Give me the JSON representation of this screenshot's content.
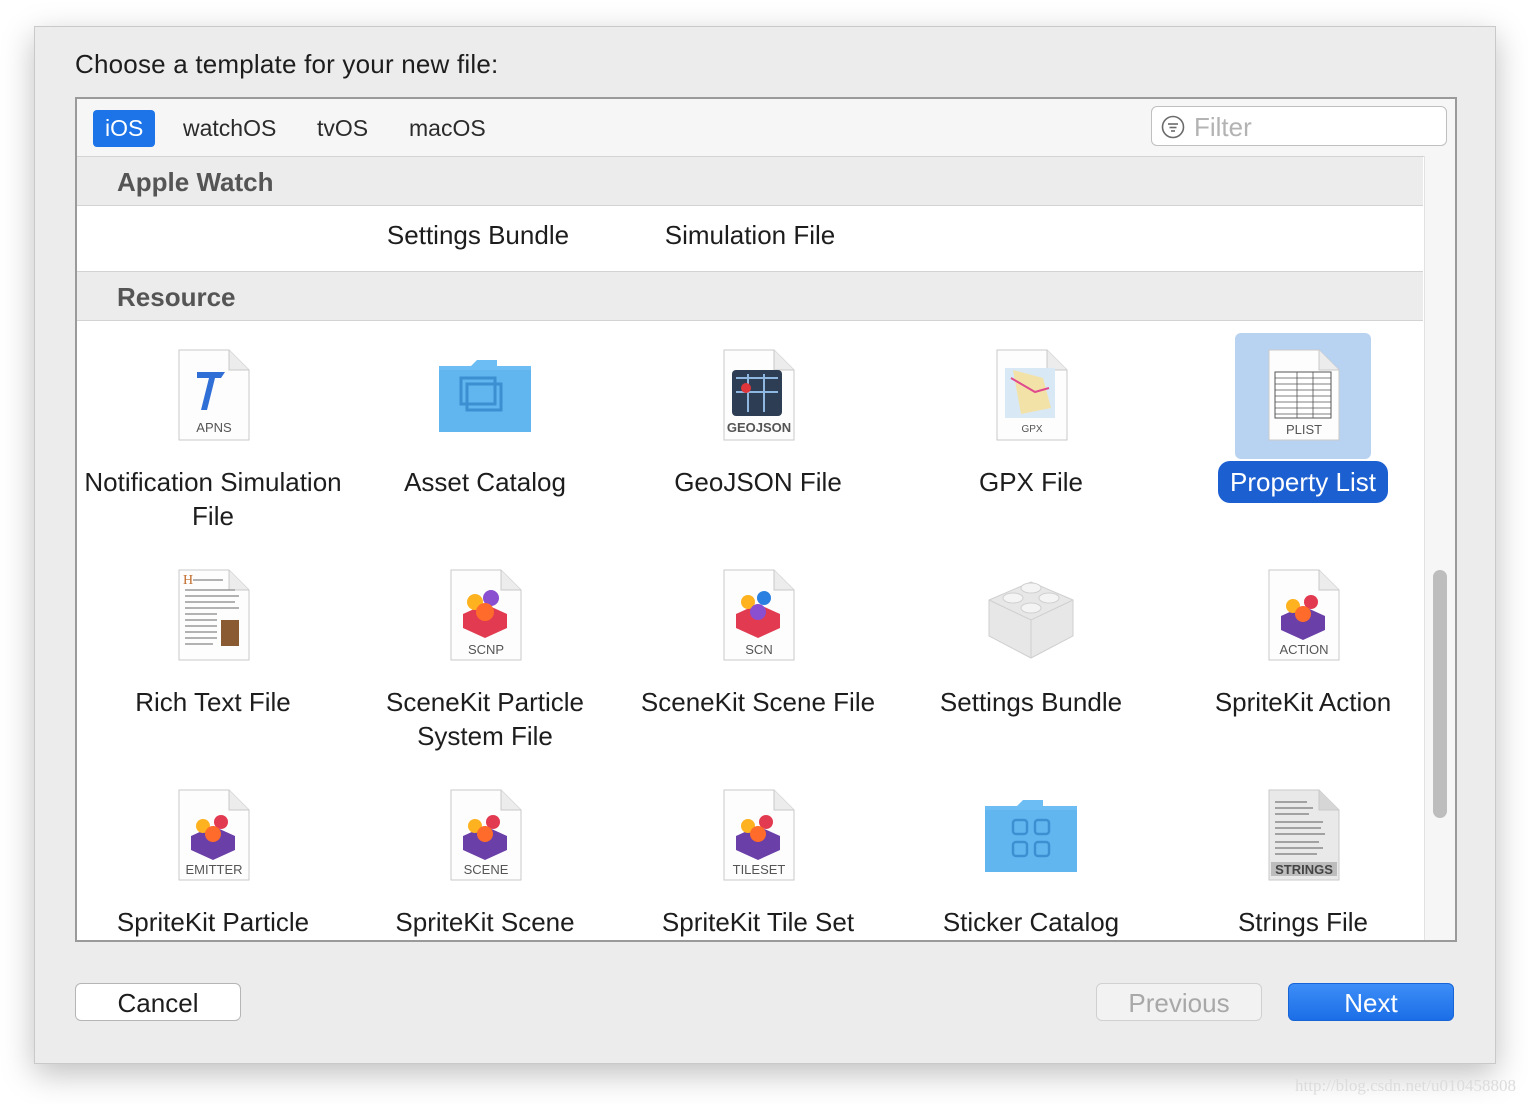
{
  "dialog": {
    "prompt": "Choose a template for your new file:",
    "cancel_label": "Cancel",
    "previous_label": "Previous",
    "next_label": "Next"
  },
  "tabs": [
    {
      "label": "iOS",
      "active": true
    },
    {
      "label": "watchOS",
      "active": false
    },
    {
      "label": "tvOS",
      "active": false
    },
    {
      "label": "macOS",
      "active": false
    }
  ],
  "filter": {
    "placeholder": "Filter",
    "value": ""
  },
  "sections": {
    "apple_watch": {
      "title": "Apple Watch",
      "partial_items": [
        "Settings Bundle",
        "Simulation File"
      ]
    },
    "resource": {
      "title": "Resource",
      "items": [
        {
          "label": "Notification Simulation File",
          "icon": "apns-file-icon",
          "tag": "APNS"
        },
        {
          "label": "Asset Catalog",
          "icon": "folder-icon",
          "tag": ""
        },
        {
          "label": "GeoJSON File",
          "icon": "geojson-file-icon",
          "tag": "GEOJSON"
        },
        {
          "label": "GPX File",
          "icon": "gpx-file-icon",
          "tag": "GPX"
        },
        {
          "label": "Property List",
          "icon": "plist-file-icon",
          "tag": "PLIST",
          "selected": true
        },
        {
          "label": "Rich Text File",
          "icon": "rich-text-file-icon",
          "tag": ""
        },
        {
          "label": "SceneKit Particle System File",
          "icon": "scnp-file-icon",
          "tag": "SCNP"
        },
        {
          "label": "SceneKit Scene File",
          "icon": "scn-file-icon",
          "tag": "SCN"
        },
        {
          "label": "Settings Bundle",
          "icon": "lego-brick-icon",
          "tag": ""
        },
        {
          "label": "SpriteKit Action",
          "icon": "action-file-icon",
          "tag": "ACTION"
        },
        {
          "label": "SpriteKit Particle",
          "icon": "emitter-file-icon",
          "tag": "EMITTER"
        },
        {
          "label": "SpriteKit Scene",
          "icon": "scene-file-icon",
          "tag": "SCENE"
        },
        {
          "label": "SpriteKit Tile Set",
          "icon": "tileset-file-icon",
          "tag": "TILESET"
        },
        {
          "label": "Sticker Catalog",
          "icon": "sticker-folder-icon",
          "tag": ""
        },
        {
          "label": "Strings File",
          "icon": "strings-file-icon",
          "tag": "STRINGS"
        }
      ]
    }
  },
  "colors": {
    "accent": "#1c74e8",
    "selection_bg": "#b8d2f1",
    "selection_label": "#1c5fd1"
  },
  "watermark": "http://blog.csdn.net/u010458808"
}
